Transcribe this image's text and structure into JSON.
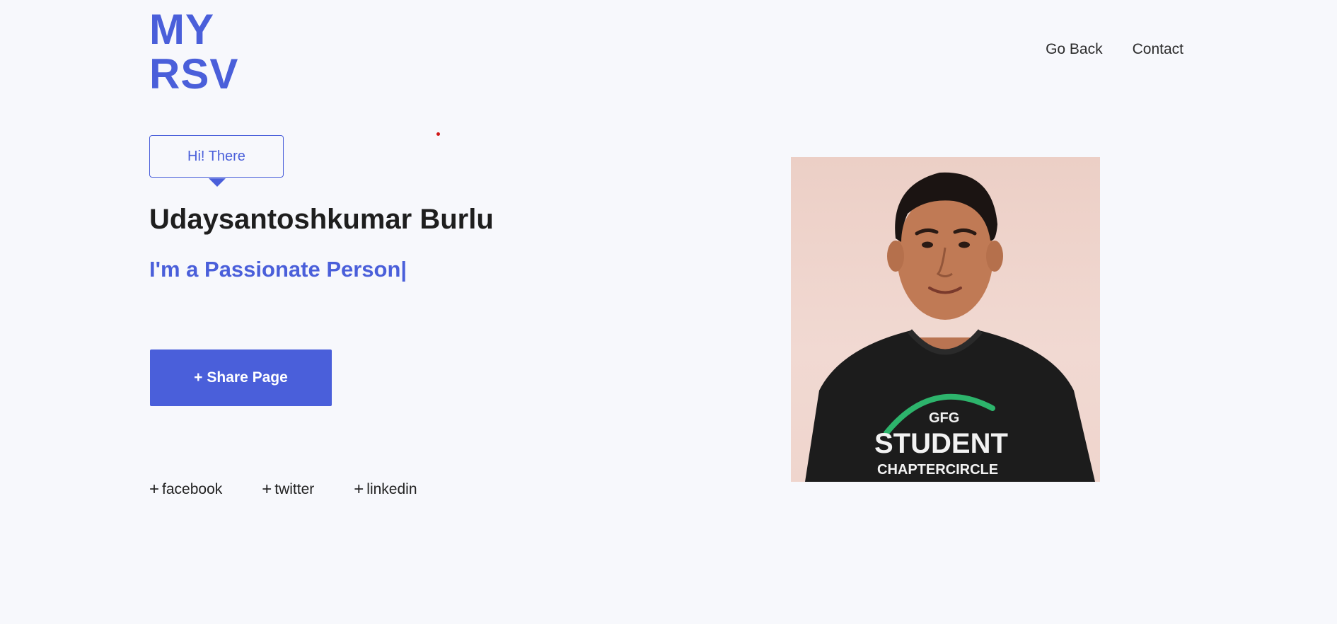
{
  "logo": {
    "line1": "MY",
    "line2": "RSV"
  },
  "nav": {
    "items": [
      {
        "label": "Go Back"
      },
      {
        "label": "Contact"
      }
    ]
  },
  "hero": {
    "greeting": "Hi! There",
    "name": "Udaysantoshkumar Burlu",
    "tagline": "I'm a Passionate Person|",
    "share_button": {
      "icon": "+",
      "label": "Share Page"
    }
  },
  "social": {
    "links": [
      {
        "icon": "+",
        "label": "facebook"
      },
      {
        "icon": "+",
        "label": "twitter"
      },
      {
        "icon": "+",
        "label": "linkedin"
      }
    ]
  },
  "portrait": {
    "shirt_text": {
      "line1": "GFG",
      "line2": "STUDENT",
      "line3": "CHAPTERCIRCLE"
    }
  },
  "colors": {
    "accent": "#4a5fda",
    "background": "#f7f8fc",
    "text": "#222222"
  }
}
